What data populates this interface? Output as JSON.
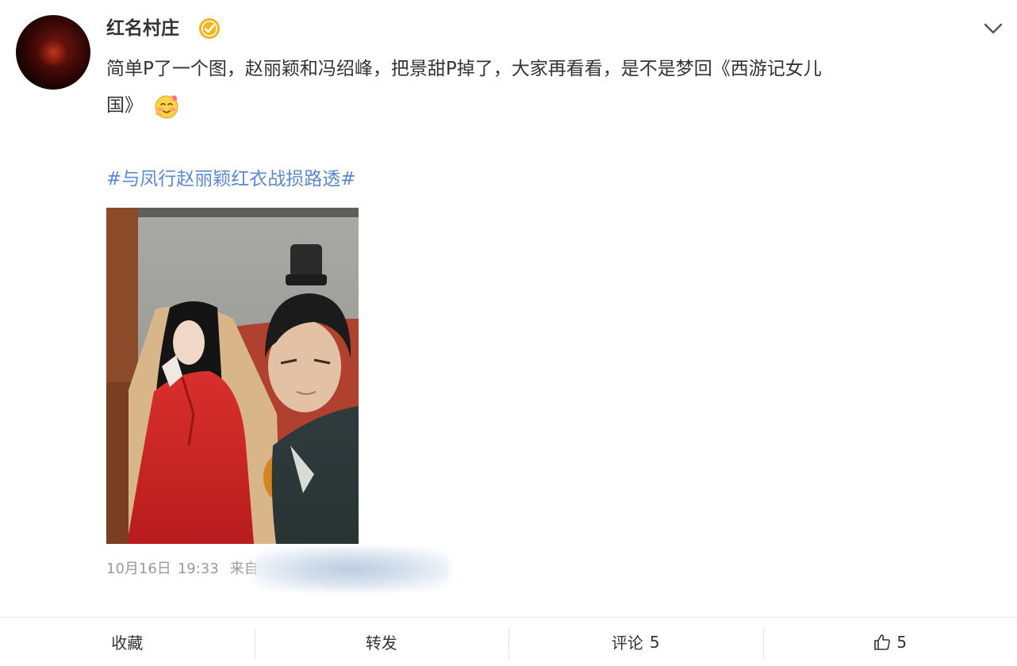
{
  "post": {
    "username": "红名村庄",
    "verified_icon": "verified-badge-icon",
    "text_line1": "简单P了一个图，赵丽颖和冯绍峰，把景甜P掉了，大家再看看，是不是梦回《西游记女儿",
    "text_line2": "国》",
    "emoji_icon": "blushing-face-emoji",
    "hashtag": "#与凤行赵丽颖红衣战损路透#",
    "date": "10月16日",
    "time": "19:33",
    "source_prefix": "来自"
  },
  "actions": {
    "favorite_label": "收藏",
    "repost_label": "转发",
    "comment_label": "评论",
    "comment_count": "5",
    "like_icon": "thumbs-up-icon",
    "like_count": "5"
  },
  "colors": {
    "link": "#5a8ad6",
    "verified": "#f5b31d",
    "text": "#333333",
    "meta": "#9a9a9a"
  }
}
